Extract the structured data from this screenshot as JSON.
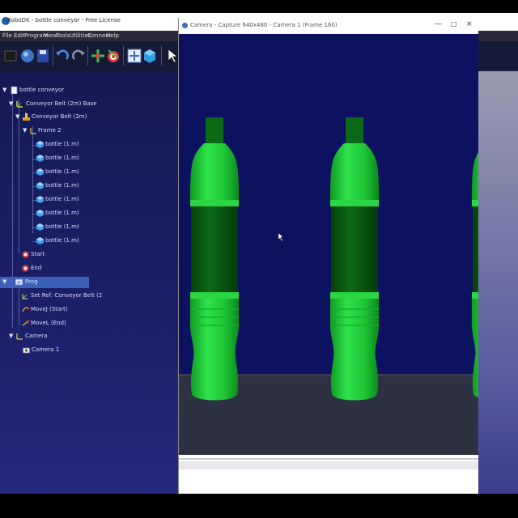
{
  "main_window": {
    "title": "RoboDK - bottle conveyor - Free License",
    "minimize_label": "—",
    "close_label": "×"
  },
  "menu": {
    "items": [
      "File",
      "Edit",
      "Program",
      "View",
      "Tools",
      "Utilities",
      "Connect",
      "Help"
    ]
  },
  "toolbar": {
    "icons": [
      "open-icon",
      "globe-icon",
      "save-icon",
      "undo-icon",
      "redo-icon",
      "add-target-icon",
      "target-icon",
      "fit-view-icon",
      "cube-view-icon",
      "select-cursor-icon"
    ]
  },
  "tree": {
    "items": [
      {
        "label": "bottle conveyor",
        "icon": "station-icon",
        "arrow": "▼"
      },
      {
        "label": "Conveyor Belt (2m) Base",
        "icon": "frame-icon",
        "arrow": "▼"
      },
      {
        "label": "Conveyor Belt (2m)",
        "icon": "robot-icon",
        "arrow": "▼"
      },
      {
        "label": "Frame 2",
        "icon": "frame-icon",
        "arrow": "▼"
      },
      {
        "label": "bottle (1.m)",
        "icon": "object-icon"
      },
      {
        "label": "bottle (1.m)",
        "icon": "object-icon"
      },
      {
        "label": "bottle (1.m)",
        "icon": "object-icon"
      },
      {
        "label": "bottle (1.m)",
        "icon": "object-icon"
      },
      {
        "label": "bottle (1.m)",
        "icon": "object-icon"
      },
      {
        "label": "bottle (1.m)",
        "icon": "object-icon"
      },
      {
        "label": "bottle (1.m)",
        "icon": "object-icon"
      },
      {
        "label": "bottle (1.m)",
        "icon": "object-icon"
      },
      {
        "label": "Start",
        "icon": "target-icon"
      },
      {
        "label": "End",
        "icon": "target-icon"
      },
      {
        "label": "Prog",
        "icon": "program-icon",
        "arrow": "▼",
        "selected": true
      },
      {
        "label": "Set Ref: Conveyor Belt (2",
        "icon": "reference-icon"
      },
      {
        "label": "MoveJ (Start)",
        "icon": "move-icon"
      },
      {
        "label": "MoveL (End)",
        "icon": "move-icon"
      },
      {
        "label": "Camera",
        "icon": "frame-icon",
        "arrow": "▼"
      },
      {
        "label": "Camera 1",
        "icon": "camera-icon"
      }
    ]
  },
  "camera_window": {
    "title": "Camera - Capture 640x480 - Camera 1 (Frame 160)",
    "minimize_label": "—",
    "maximize_label": "□",
    "close_label": "×"
  },
  "colors": {
    "tree_bg": "#1b206a",
    "selected_row": "#3a60b8",
    "viewport_bg": "#0c1160",
    "bottle_green": "#1fd13a",
    "bottle_dark": "#0a5a14",
    "conveyor": "#2e3142"
  }
}
